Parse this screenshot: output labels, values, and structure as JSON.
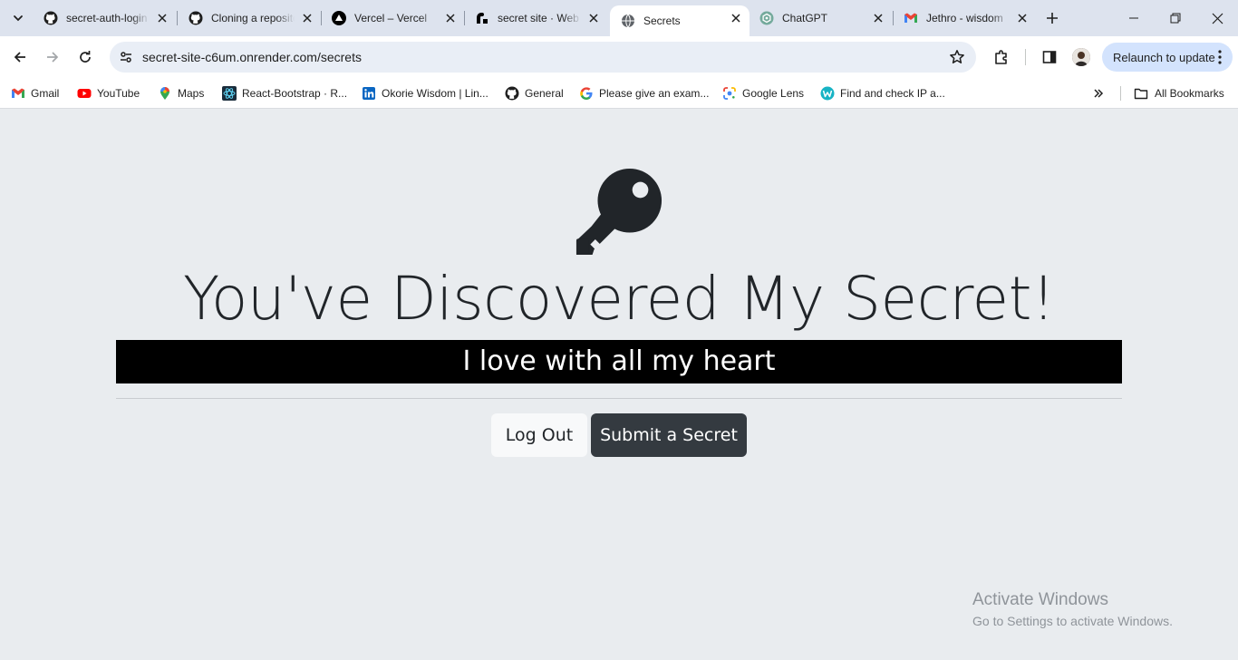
{
  "browser": {
    "tabs": [
      {
        "title": "secret-auth-login",
        "favicon": "github-icon",
        "active": false
      },
      {
        "title": "Cloning a repository",
        "favicon": "github-icon",
        "active": false
      },
      {
        "title": "Vercel – Vercel",
        "favicon": "vercel-icon",
        "active": false
      },
      {
        "title": "secret site · Web Service",
        "favicon": "render-icon",
        "active": false
      },
      {
        "title": "Secrets",
        "favicon": "globe-icon",
        "active": true
      },
      {
        "title": "ChatGPT",
        "favicon": "chatgpt-icon",
        "active": false
      },
      {
        "title": "Jethro - wisdom",
        "favicon": "gmail-icon",
        "active": false
      }
    ],
    "url": "secret-site-c6um.onrender.com/secrets",
    "relaunch_label": "Relaunch to update",
    "bookmarks": [
      {
        "label": "Gmail",
        "icon": "gmail-icon"
      },
      {
        "label": "YouTube",
        "icon": "youtube-icon"
      },
      {
        "label": "Maps",
        "icon": "maps-icon"
      },
      {
        "label": "React-Bootstrap · R...",
        "icon": "react-bootstrap-icon"
      },
      {
        "label": "Okorie Wisdom | Lin...",
        "icon": "linkedin-icon"
      },
      {
        "label": "General",
        "icon": "github-icon"
      },
      {
        "label": "Please give an exam...",
        "icon": "google-icon"
      },
      {
        "label": "Google Lens",
        "icon": "google-lens-icon"
      },
      {
        "label": "Find and check IP a...",
        "icon": "whatismyip-icon"
      }
    ],
    "all_bookmarks_label": "All Bookmarks",
    "colors": {
      "tabstrip": "#dde3ee",
      "omnibox": "#e9eef6",
      "relaunch": "#d3e3fd"
    }
  },
  "page": {
    "icon": "key-icon",
    "heading": "You've Discovered My Secret!",
    "secret": "I love with all my heart",
    "logout_label": "Log Out",
    "submit_label": "Submit a Secret",
    "colors": {
      "background": "#e9ecef",
      "band": "#000000",
      "dark_button": "#343a40",
      "light_button": "#f8f9fa"
    }
  },
  "watermark": {
    "title": "Activate Windows",
    "subtitle": "Go to Settings to activate Windows."
  }
}
